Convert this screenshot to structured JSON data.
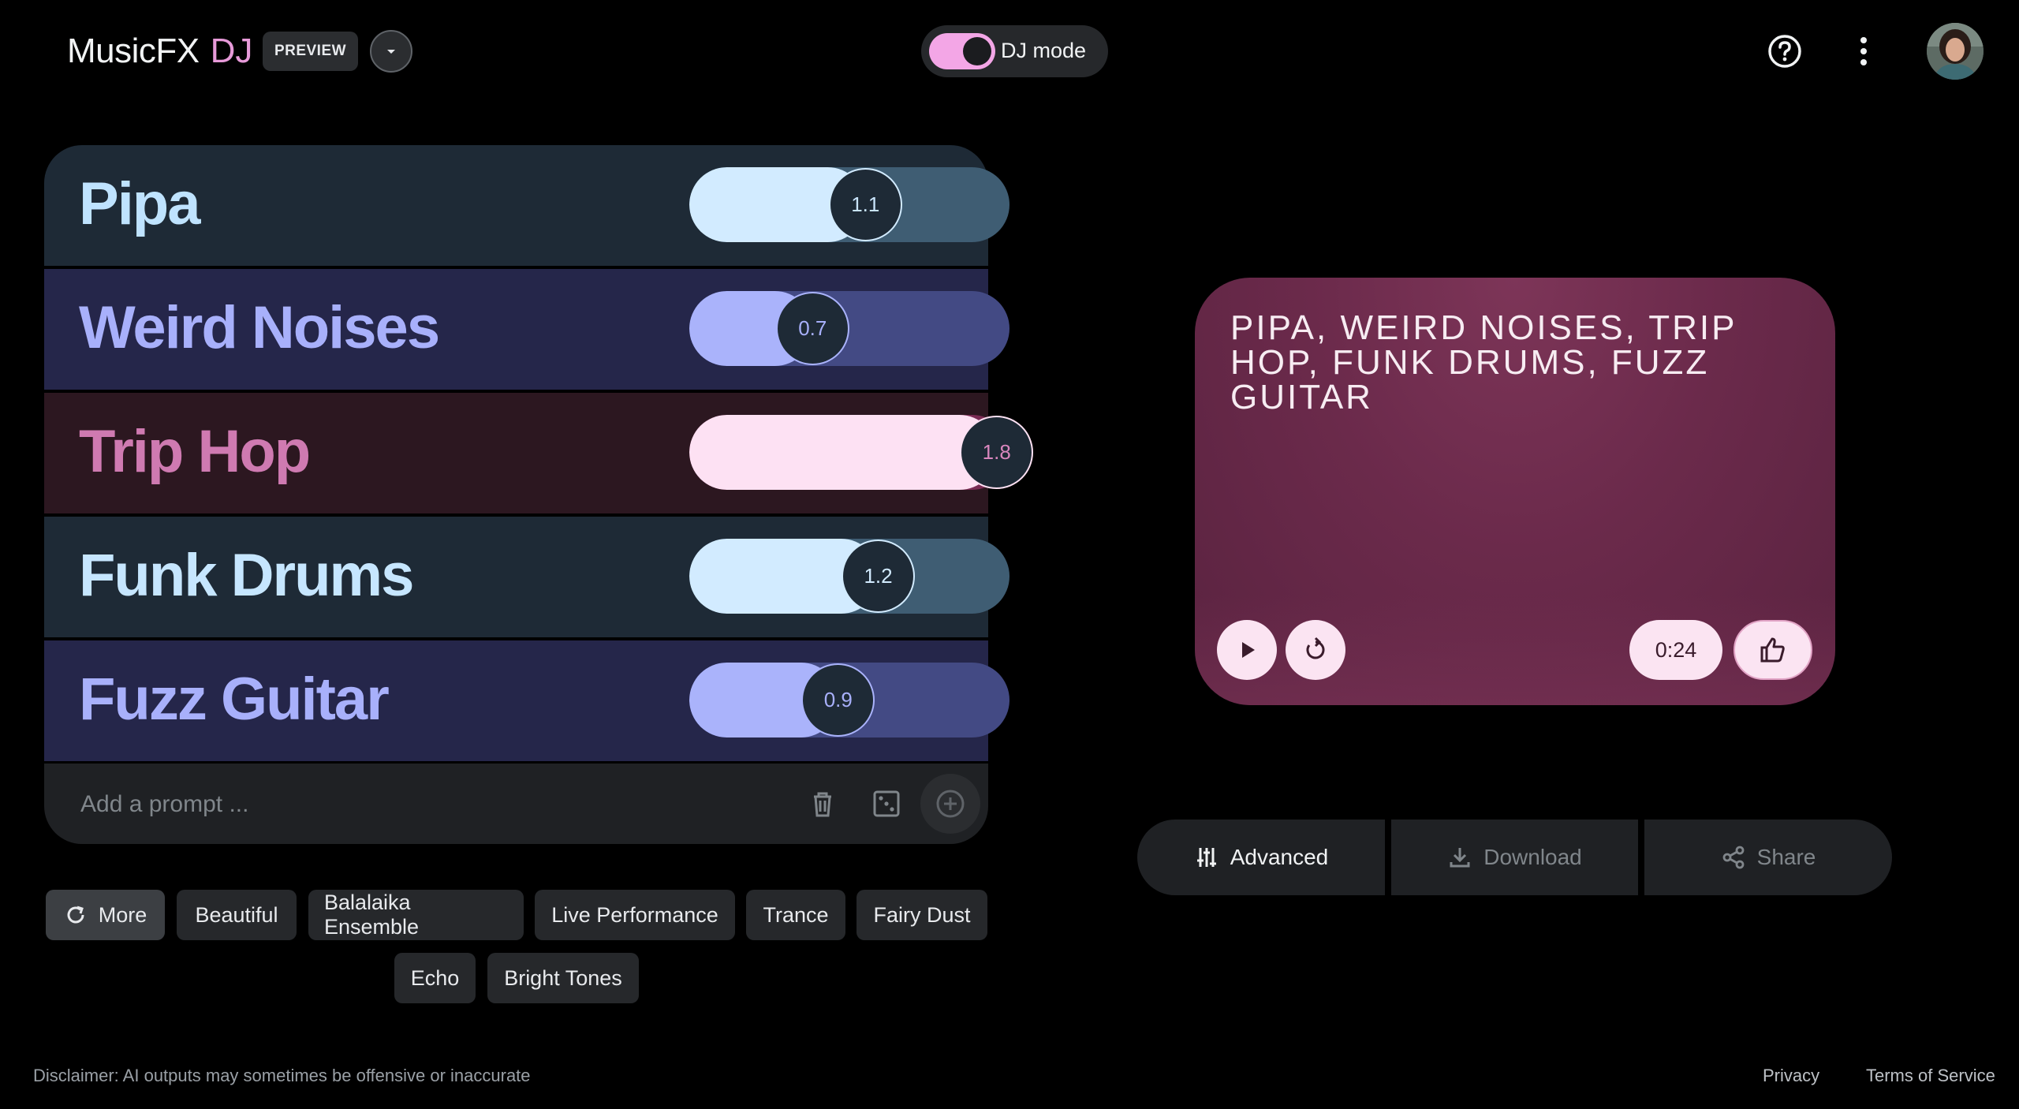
{
  "header": {
    "app_name": "MusicFX",
    "app_suffix": "DJ",
    "badge": "PREVIEW",
    "dj_mode_label": "DJ mode",
    "dj_mode_on": true
  },
  "prompts": [
    {
      "label": "Pipa",
      "weight": "1.1",
      "level": 0.55,
      "text_color": "#bfe3ff",
      "card_bg": "#1e2a36",
      "fill": "#d2ebff",
      "track": "#3f5d73",
      "thumb_text": "#c9e4fb"
    },
    {
      "label": "Weird Noises",
      "weight": "0.7",
      "level": 0.385,
      "text_color": "#a8b0fb",
      "card_bg": "#25264a",
      "fill": "#aab3fb",
      "track": "#434a84",
      "thumb_text": "#a8b0fb"
    },
    {
      "label": "Trip Hop",
      "weight": "1.8",
      "level": 0.96,
      "text_color": "#cf7ab1",
      "card_bg": "#2c1720",
      "fill": "#fde1f3",
      "track": "#7a2b54",
      "thumb_text": "#d886bd"
    },
    {
      "label": "Funk Drums",
      "weight": "1.2",
      "level": 0.59,
      "text_color": "#c6e6ff",
      "card_bg": "#1e2a36",
      "fill": "#d2ebff",
      "track": "#3f5d73",
      "thumb_text": "#d2ebff"
    },
    {
      "label": "Fuzz Guitar",
      "weight": "0.9",
      "level": 0.465,
      "text_color": "#a8b0fb",
      "card_bg": "#25264a",
      "fill": "#aab3fb",
      "track": "#434a84",
      "thumb_text": "#a8b0fb"
    }
  ],
  "add_prompt": {
    "placeholder": "Add a prompt ..."
  },
  "chips": {
    "more": "More",
    "items": [
      "Beautiful",
      "Balalaika Ensemble",
      "Live Performance",
      "Trance",
      "Fairy Dust",
      "Echo",
      "Bright Tones"
    ]
  },
  "player": {
    "title": "PIPA, WEIRD NOISES, TRIP HOP, FUNK DRUMS, FUZZ GUITAR",
    "time": "0:24"
  },
  "actions": {
    "advanced": "Advanced",
    "download": "Download",
    "share": "Share"
  },
  "footer": {
    "disclaimer": "Disclaimer: AI outputs may sometimes be offensive or inaccurate",
    "privacy": "Privacy",
    "terms": "Terms of Service"
  },
  "icons": [
    "chevron-down-icon",
    "help-icon",
    "more-vert-icon",
    "trash-icon",
    "dice-icon",
    "add-circle-icon",
    "refresh-icon",
    "play-icon",
    "replay-icon",
    "thumb-up-icon",
    "tune-icon",
    "download-icon",
    "share-icon"
  ]
}
